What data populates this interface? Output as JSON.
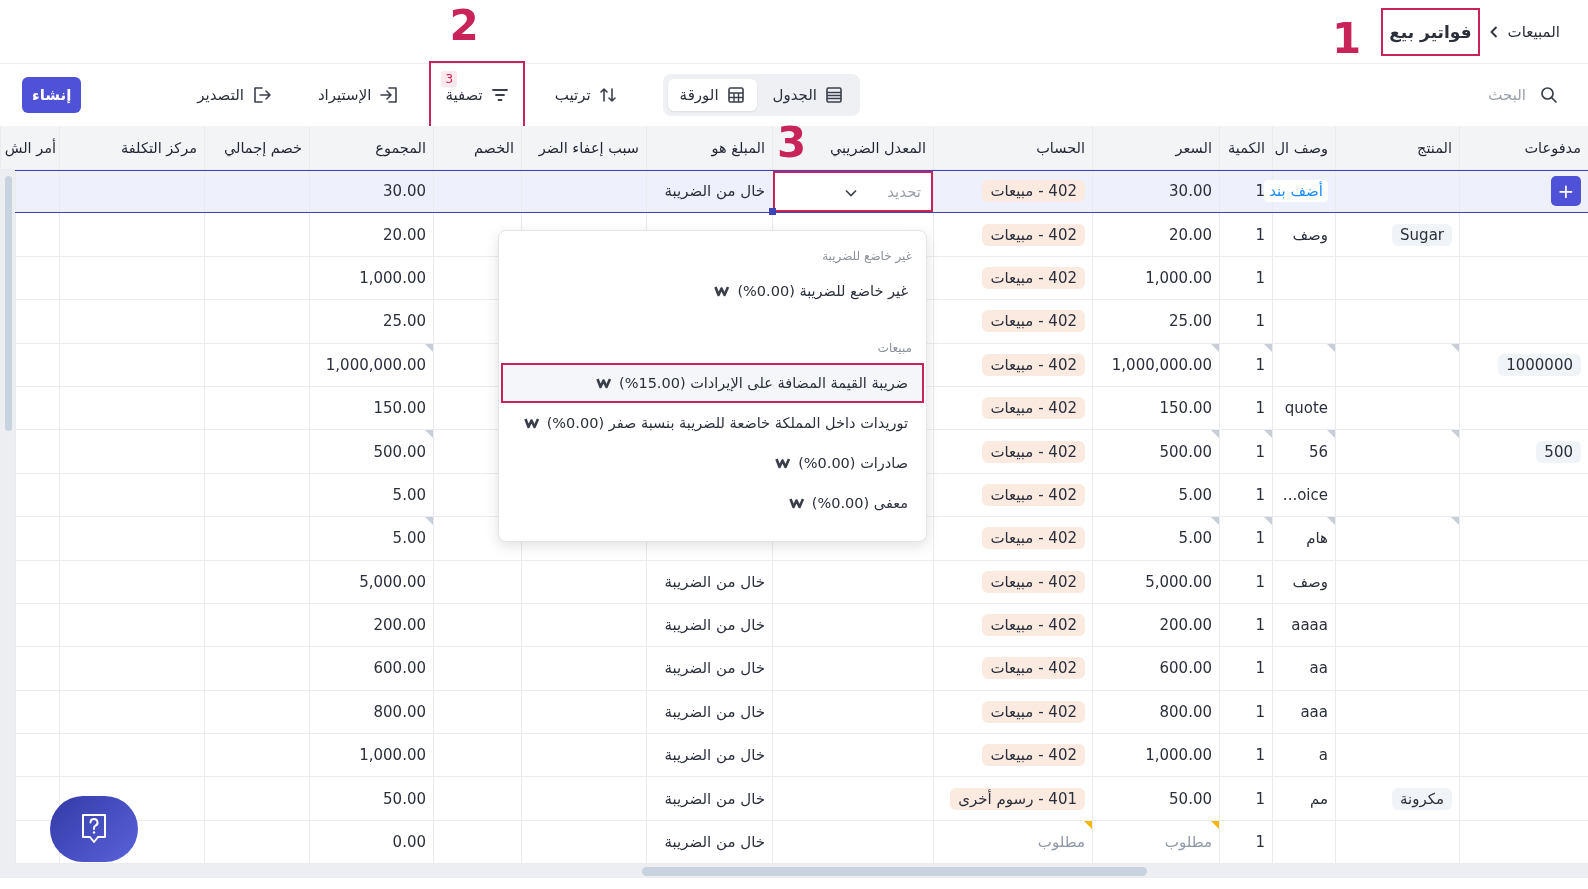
{
  "breadcrumb": {
    "parent": "المبيعات",
    "current": "فواتير بيع",
    "current_outlined": true,
    "annotation": "1"
  },
  "toolbar": {
    "search": {
      "placeholder": "البحث"
    },
    "views": [
      {
        "kind": "table",
        "label": "الجدول",
        "selected": false
      },
      {
        "kind": "sheet",
        "label": "الورقة",
        "selected": true
      }
    ],
    "tools": [
      {
        "kind": "sort",
        "label": "ترتيب",
        "outlined": false
      },
      {
        "kind": "filter",
        "label": "تصفية",
        "badge": "3",
        "outlined": true,
        "annotation": "2"
      },
      {
        "kind": "import",
        "label": "الإستيراد",
        "outlined": false
      },
      {
        "kind": "export",
        "label": "التصدير",
        "outlined": false
      }
    ],
    "create_button": "إنشاء"
  },
  "table": {
    "columns": [
      {
        "label": "مدفوعات"
      },
      {
        "label": "المنتج"
      },
      {
        "label": "وصف ال"
      },
      {
        "label": "الكمية"
      },
      {
        "label": "السعر"
      },
      {
        "label": "الحساب"
      },
      {
        "label": "المعدل الضريبي",
        "annotation": "3"
      },
      {
        "label": "المبلغ هو"
      },
      {
        "label": "سبب إعفاء الضر"
      },
      {
        "label": "الخصم"
      },
      {
        "label": "المجموع"
      },
      {
        "label": "خصم إجمالي"
      },
      {
        "label": "مركز التكلفة"
      },
      {
        "label": "أمر الش"
      }
    ],
    "rows": [
      {
        "selected": true,
        "marked": false,
        "add_button": "+",
        "add_link": "أضف بند",
        "quantity": "1",
        "price": "30.00",
        "account": "402 - مبيعات",
        "tax_field": {
          "placeholder": "تحديد",
          "outlined": true
        },
        "amount_type": "خال من الضريبة",
        "total": "30.00"
      },
      {
        "selected": false,
        "marked": false,
        "product": "Sugar",
        "description": "وصف",
        "quantity": "1",
        "price": "20.00",
        "account": "402 - مبيعات",
        "total": "20.00"
      },
      {
        "selected": false,
        "marked": false,
        "quantity": "1",
        "price": "1,000.00",
        "account": "402 - مبيعات",
        "total": "1,000.00"
      },
      {
        "selected": false,
        "marked": false,
        "quantity": "1",
        "price": "25.00",
        "account": "402 - مبيعات",
        "total": "25.00"
      },
      {
        "selected": false,
        "marked": true,
        "payment": "1000000",
        "quantity": "1",
        "price": "1,000,000.00",
        "account": "402 - مبيعات",
        "total": "1,000,000.00"
      },
      {
        "selected": false,
        "marked": false,
        "description": "quote",
        "quantity": "1",
        "price": "150.00",
        "account": "402 - مبيعات",
        "total": "150.00"
      },
      {
        "selected": false,
        "marked": true,
        "payment": "500",
        "description": "56",
        "quantity": "1",
        "price": "500.00",
        "account": "402 - مبيعات",
        "total": "500.00"
      },
      {
        "selected": false,
        "marked": false,
        "description": "oice...",
        "quantity": "1",
        "price": "5.00",
        "account": "402 - مبيعات",
        "total": "5.00"
      },
      {
        "selected": false,
        "marked": true,
        "description": "هام",
        "quantity": "1",
        "price": "5.00",
        "account": "402 - مبيعات",
        "total": "5.00"
      },
      {
        "selected": false,
        "marked": false,
        "description": "وصف",
        "quantity": "1",
        "price": "5,000.00",
        "account": "402 - مبيعات",
        "amount_type": "خال من الضريبة",
        "total": "5,000.00"
      },
      {
        "selected": false,
        "marked": false,
        "description": "aaaa",
        "quantity": "1",
        "price": "200.00",
        "account": "402 - مبيعات",
        "amount_type": "خال من الضريبة",
        "total": "200.00"
      },
      {
        "selected": false,
        "marked": false,
        "description": "aa",
        "quantity": "1",
        "price": "600.00",
        "account": "402 - مبيعات",
        "amount_type": "خال من الضريبة",
        "total": "600.00"
      },
      {
        "selected": false,
        "marked": false,
        "description": "aaa",
        "quantity": "1",
        "price": "800.00",
        "account": "402 - مبيعات",
        "amount_type": "خال من الضريبة",
        "total": "800.00"
      },
      {
        "selected": false,
        "marked": false,
        "description": "a",
        "quantity": "1",
        "price": "1,000.00",
        "account": "402 - مبيعات",
        "amount_type": "خال من الضريبة",
        "total": "1,000.00"
      },
      {
        "selected": false,
        "marked": false,
        "product": "مكرونة",
        "description": "مم",
        "quantity": "1",
        "price": "50.00",
        "account": "401 - رسوم أخرى",
        "amount_type": "خال من الضريبة",
        "total": "50.00"
      },
      {
        "selected": false,
        "marked": false,
        "quantity": "1",
        "price_placeholder": "مطلوب",
        "account_placeholder": "مطلوب",
        "amount_type": "خال من الضريبة",
        "total": "0.00"
      }
    ]
  },
  "tax_dropdown": {
    "groups": [
      {
        "heading": "غير خاضع للضريبة",
        "options": [
          {
            "label": "غير خاضع للضريبة (0.00%)",
            "highlighted": false
          }
        ]
      },
      {
        "heading": "مبيعات",
        "options": [
          {
            "label": "ضريبة القيمة المضافة على الإيرادات (15.00%)",
            "highlighted": true
          },
          {
            "label": "توريدات داخل المملكة خاضعة للضريبة بنسبة صفر (0.00%)",
            "highlighted": false
          },
          {
            "label": "صادرات (0.00%)",
            "highlighted": false
          },
          {
            "label": "معفى (0.00%)",
            "highlighted": false
          }
        ]
      }
    ]
  }
}
